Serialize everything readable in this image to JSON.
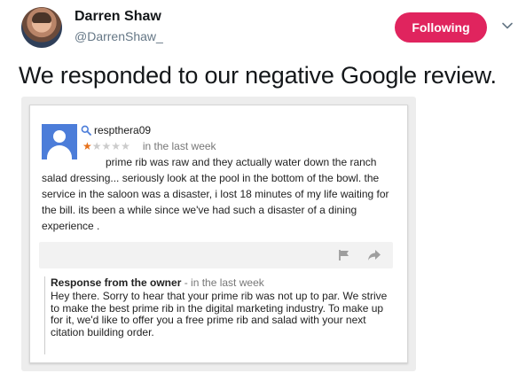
{
  "tweet": {
    "user_name": "Darren Shaw",
    "user_handle": "@DarrenShaw_",
    "follow_label": "Following",
    "text": "We responded to our negative Google review."
  },
  "review": {
    "reviewer": "respthera09",
    "rating": 1,
    "max_rating": 5,
    "time": "in the last week",
    "body": "prime rib was raw and they actually water down the ranch salad dressing... seriously look at the pool in the bottom of the bowl. the service in the saloon was a disaster, i lost 18 minutes of my life waiting for the bill. its been a while since we've had such a disaster of a dining experience ."
  },
  "response": {
    "title": "Response from the owner",
    "separator": " - ",
    "time": "in the last week",
    "body": "Hey there. Sorry to hear that your prime rib was not up to par. We strive to make the best prime rib in the digital marketing industry. To make up for it, we'd like to offer you a free prime rib and salad with your next citation building order."
  },
  "icons": {
    "caret": "chevron-down-icon",
    "search": "search-icon",
    "flag": "flag-icon",
    "share": "share-arrow-icon",
    "avatar": "default-user-icon"
  },
  "colors": {
    "follow_bg": "#e0245e",
    "star_filled": "#e7711b",
    "star_empty": "#cccccc",
    "reviewer_avatar": "#4c7dd9"
  }
}
